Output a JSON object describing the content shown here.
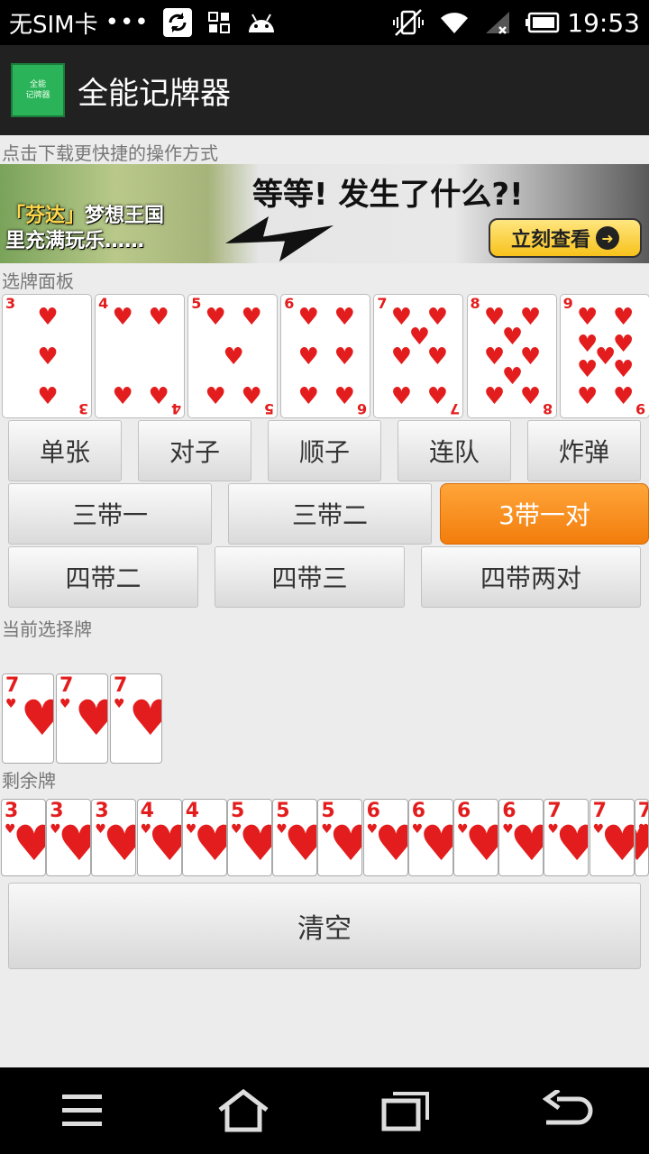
{
  "status_bar": {
    "carrier": "无SIM卡",
    "more": "•••",
    "time": "19:53"
  },
  "app": {
    "title": "全能记牌器",
    "logo_text_top": "全能",
    "logo_text_bottom": "记牌器"
  },
  "ad": {
    "label": "点击下载更快捷的操作方式",
    "left_line1_prefix": "「芬达」",
    "left_line1": "梦想王国",
    "left_line2": "里充满玩乐……",
    "headline": "等等! 发生了什么?!",
    "cta": "立刻查看"
  },
  "panel": {
    "label": "选牌面板",
    "cards": [
      {
        "rank": "3",
        "suit": "♥"
      },
      {
        "rank": "4",
        "suit": "♥"
      },
      {
        "rank": "5",
        "suit": "♥"
      },
      {
        "rank": "6",
        "suit": "♥"
      },
      {
        "rank": "7",
        "suit": "♥"
      },
      {
        "rank": "8",
        "suit": "♥"
      },
      {
        "rank": "9",
        "suit": "♥"
      }
    ]
  },
  "play_types": {
    "row1": [
      "单张",
      "对子",
      "顺子",
      "连队",
      "炸弹"
    ],
    "row2": [
      "三带一",
      "三带二",
      "3带一对"
    ],
    "row3": [
      "四带二",
      "四带三",
      "四带两对"
    ],
    "active": "3带一对"
  },
  "current": {
    "label": "当前选择牌",
    "cards": [
      "7",
      "7",
      "7"
    ]
  },
  "remaining": {
    "label": "剩余牌",
    "cards": [
      "3",
      "3",
      "3",
      "4",
      "4",
      "5",
      "5",
      "5",
      "6",
      "6",
      "6",
      "6",
      "7",
      "7",
      "7"
    ]
  },
  "clear_label": "清空",
  "colors": {
    "active_button": "#f27d0c",
    "card_red": "#e31d1d",
    "logo_green": "#2bb35a"
  }
}
